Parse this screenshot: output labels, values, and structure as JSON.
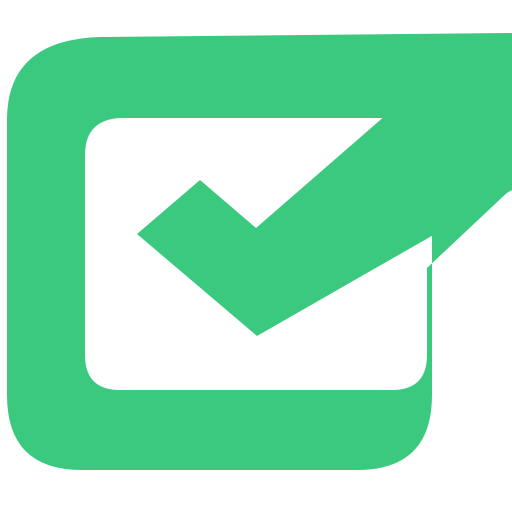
{
  "icon": {
    "name": "checkbox-check-icon",
    "accent_color": "#3BC97F",
    "background_color": "#FFFFFF"
  }
}
